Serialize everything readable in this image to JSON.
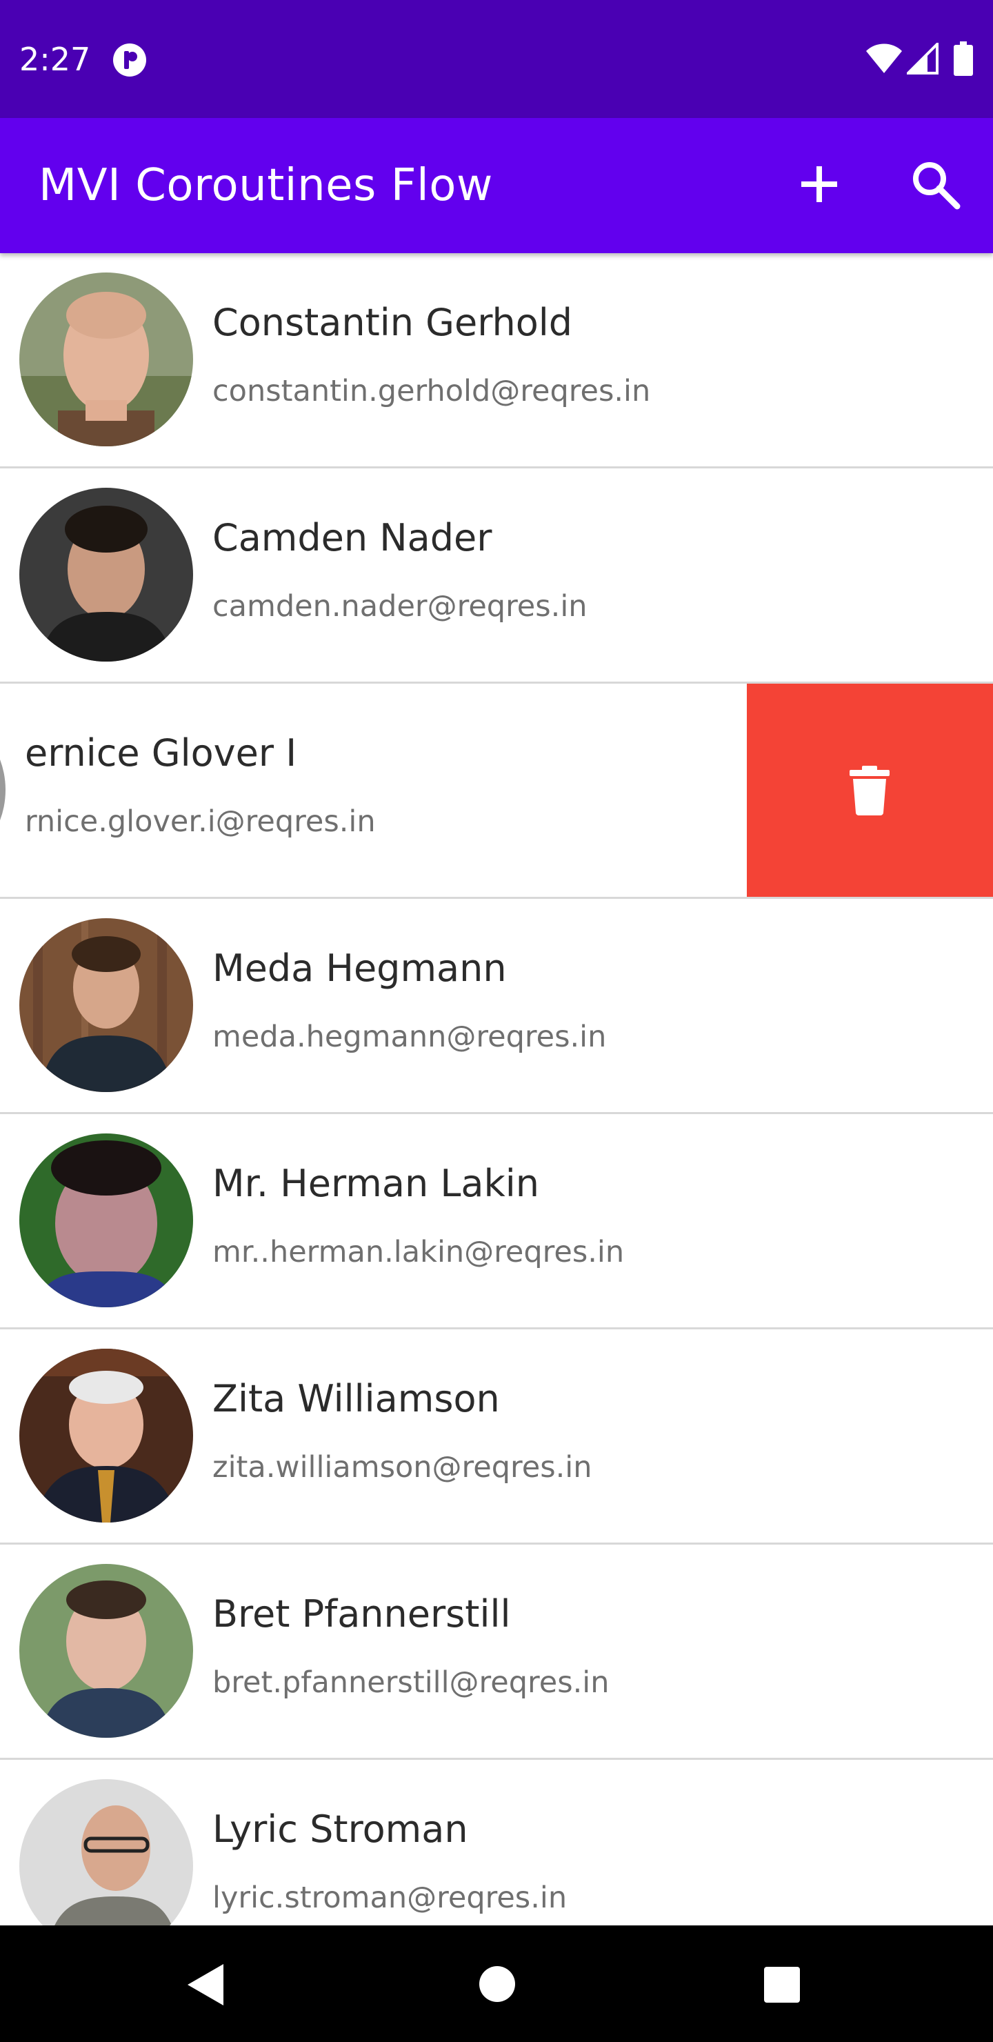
{
  "status_bar": {
    "time": "2:27",
    "icons": [
      "app-notification-icon",
      "wifi-icon",
      "cell-signal-icon",
      "battery-icon"
    ]
  },
  "app_bar": {
    "title": "MVI Coroutines Flow",
    "actions": [
      "add-icon",
      "search-icon"
    ]
  },
  "users": [
    {
      "name": "Constantin Gerhold",
      "email": "constantin.gerhold@reqres.in"
    },
    {
      "name": "Camden Nader",
      "email": "camden.nader@reqres.in"
    },
    {
      "name": "ernice Glover I",
      "email": "rnice.glover.i@reqres.in"
    },
    {
      "name": "Meda Hegmann",
      "email": "meda.hegmann@reqres.in"
    },
    {
      "name": "Mr. Herman Lakin",
      "email": "mr..herman.lakin@reqres.in"
    },
    {
      "name": "Zita Williamson",
      "email": "zita.williamson@reqres.in"
    },
    {
      "name": "Bret Pfannerstill",
      "email": "bret.pfannerstill@reqres.in"
    },
    {
      "name": "Lyric Stroman",
      "email": "lyric.stroman@reqres.in"
    }
  ],
  "delete_action": {
    "icon": "trash-icon"
  },
  "nav_bar": {
    "icons": [
      "back-icon",
      "home-icon",
      "recents-icon"
    ]
  },
  "colors": {
    "status_bar": "#4a00b3",
    "app_bar": "#6200ee",
    "delete": "#f44336",
    "name_text": "#2b2b2b",
    "email_text": "#6f6f6f",
    "divider": "#d8d8d8"
  }
}
